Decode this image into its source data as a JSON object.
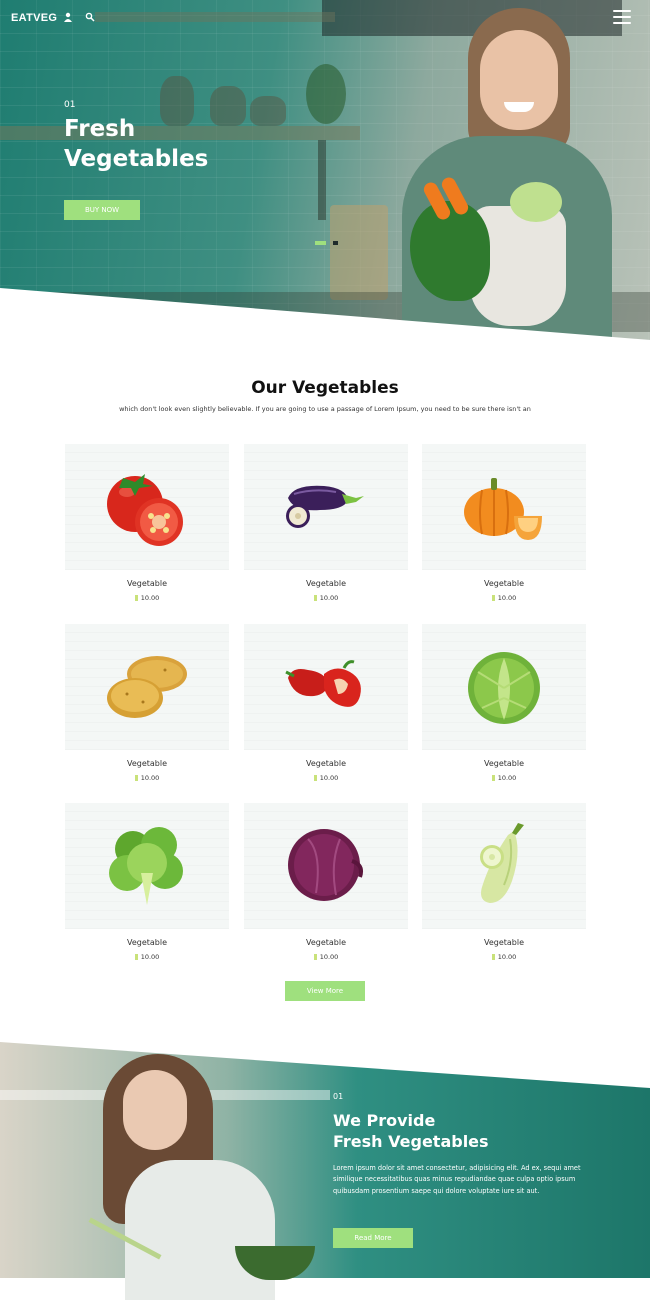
{
  "header": {
    "logo": "EATVEG",
    "icons": [
      "user-icon",
      "search-icon",
      "menu-icon"
    ]
  },
  "hero": {
    "slide_number": "01",
    "title_line1": "Fresh",
    "title_line2": "Vegetables",
    "cta_label": "BUY NOW",
    "slide_count": 2,
    "active_slide": 1
  },
  "products": {
    "title": "Our Vegetables",
    "subtitle": "which don't look even slightly believable. If you are going to use a passage of Lorem Ipsum, you need to be sure there isn't an",
    "items": [
      {
        "name": "Vegetable",
        "price": "10.00",
        "icon": "tomato-icon"
      },
      {
        "name": "Vegetable",
        "price": "10.00",
        "icon": "eggplant-icon"
      },
      {
        "name": "Vegetable",
        "price": "10.00",
        "icon": "pumpkin-icon"
      },
      {
        "name": "Vegetable",
        "price": "10.00",
        "icon": "potato-icon"
      },
      {
        "name": "Vegetable",
        "price": "10.00",
        "icon": "red-pepper-icon"
      },
      {
        "name": "Vegetable",
        "price": "10.00",
        "icon": "cabbage-icon"
      },
      {
        "name": "Vegetable",
        "price": "10.00",
        "icon": "lettuce-icon"
      },
      {
        "name": "Vegetable",
        "price": "10.00",
        "icon": "red-cabbage-icon"
      },
      {
        "name": "Vegetable",
        "price": "10.00",
        "icon": "zucchini-icon"
      }
    ],
    "more_label": "View More"
  },
  "about": {
    "number": "01",
    "title_line1": "We Provide",
    "title_line2": "Fresh Vegetables",
    "text": "Lorem ipsum dolor sit amet consectetur, adipisicing elit. Ad ex, sequi amet similique necessitatibus quas minus repudiandae quae culpa optio ipsum quibusdam prosentium saepe qui dolore voluptate iure sit aut.",
    "cta_label": "Read More"
  },
  "colors": {
    "accent": "#9fe07e",
    "overlay": "#1f7d71"
  }
}
